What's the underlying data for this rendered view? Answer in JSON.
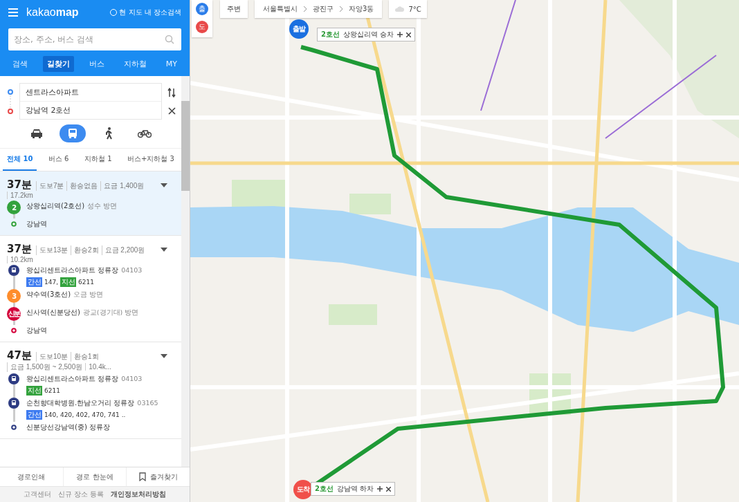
{
  "header": {
    "logo": "kakao**map**",
    "map_search": {
      "label": "현 지도 내 장소검색",
      "checked": false
    },
    "search": {
      "placeholder": "장소, 주소, 버스 검색"
    }
  },
  "nav_tabs": [
    {
      "label": "검색",
      "selected": false
    },
    {
      "label": "길찾기",
      "selected": true
    },
    {
      "label": "버스",
      "selected": false
    },
    {
      "label": "지하철",
      "selected": false
    },
    {
      "label": "MY",
      "selected": false
    }
  ],
  "route_inputs": {
    "origin": "센트라스아파트",
    "destination": "강남역 2호선"
  },
  "modes": [
    {
      "kind": "car",
      "selected": false
    },
    {
      "kind": "transit",
      "selected": true
    },
    {
      "kind": "walk",
      "selected": false
    },
    {
      "kind": "bike",
      "selected": false
    }
  ],
  "result_tabs": [
    {
      "label": "전체 10",
      "selected": true
    },
    {
      "label": "버스 6",
      "selected": false
    },
    {
      "label": "지하철 1",
      "selected": false
    },
    {
      "label": "버스+지하철 3",
      "selected": false
    }
  ],
  "routes": [
    {
      "time": "37분",
      "selected": true,
      "summary": [
        "도보7분",
        "환승없음",
        "요금 1,400원",
        "17.2km"
      ],
      "steps": [
        {
          "kind": "subway",
          "badge": "2",
          "color": "#33a23d",
          "name": "상왕십리역(2호선)",
          "note": "성수 방면"
        },
        {
          "kind": "end",
          "color": "#33a23d",
          "name": "강남역"
        }
      ]
    },
    {
      "time": "37분",
      "selected": false,
      "summary": [
        "도보13분",
        "환승2회",
        "요금 2,200원",
        "10.2km"
      ],
      "steps": [
        {
          "kind": "bus",
          "color": "#2d3b82",
          "name": "왕십리센트라스아파트 정류장",
          "note": "04103",
          "lines": [
            {
              "type": "간선",
              "color": "#3d7bf0",
              "numbers": "147,"
            },
            {
              "type": "지선",
              "color": "#33a23d",
              "numbers": "6211"
            }
          ]
        },
        {
          "kind": "subway",
          "badge": "3",
          "color": "#fe8d2c",
          "name": "약수역(3호선)",
          "note": "오금 방면"
        },
        {
          "kind": "subway",
          "badge": "신분",
          "color": "#d4003b",
          "name": "신사역(신분당선)",
          "note": "광교(경기대) 방면"
        },
        {
          "kind": "end",
          "color": "#d4003b",
          "name": "강남역"
        }
      ]
    },
    {
      "time": "47분",
      "selected": false,
      "summary": [
        "도보10분",
        "환승1회",
        "요금 1,500원 ~ 2,500원",
        "10.4k..."
      ],
      "steps": [
        {
          "kind": "bus",
          "color": "#2d3b82",
          "name": "왕십리센트라스아파트 정류장",
          "note": "04103",
          "lines": [
            {
              "type": "지선",
              "color": "#33a23d",
              "numbers": "6211"
            }
          ]
        },
        {
          "kind": "bus",
          "color": "#2d3b82",
          "name": "순천향대학병원.한남오거리 정류장",
          "note": "03165",
          "lines": [
            {
              "type": "간선",
              "color": "#3d7bf0",
              "numbers": "140, 420, 402, 470, 741 .."
            }
          ]
        },
        {
          "kind": "end",
          "color": "#2d3b82",
          "name": "신분당선강남역(중) 정류장"
        }
      ]
    }
  ],
  "footer_buttons": [
    {
      "kind": "plain",
      "label": "경로인쇄"
    },
    {
      "kind": "plain",
      "label": "경로 한눈에"
    },
    {
      "kind": "bookmark",
      "label": "즐겨찾기"
    }
  ],
  "footer_links": [
    {
      "label": "고객센터",
      "bold": false
    },
    {
      "label": "신규 장소 등록",
      "bold": false
    },
    {
      "label": "개인정보처리방침",
      "bold": true
    }
  ],
  "map": {
    "pins": [
      {
        "label": "출",
        "color": "#2b7de9"
      },
      {
        "label": "도",
        "color": "#e84a4a"
      }
    ],
    "nearby": "주변",
    "breadcrumb": [
      "서울특별시",
      "광진구",
      "자양3동"
    ],
    "weather": "7°C",
    "start": {
      "marker": "출발",
      "line": "2호선",
      "text": "상왕십리역 승차"
    },
    "end": {
      "marker": "도착",
      "line": "2호선",
      "text": "강남역 하차"
    }
  }
}
